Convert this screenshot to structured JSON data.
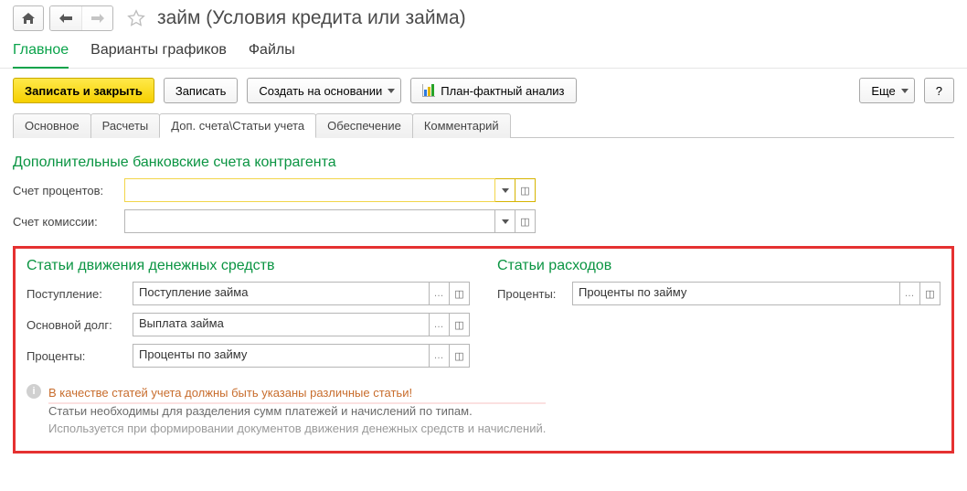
{
  "title": "займ (Условия кредита или займа)",
  "navTabs": {
    "main": "Главное",
    "scheduleVariants": "Варианты графиков",
    "files": "Файлы"
  },
  "toolbar": {
    "saveClose": "Записать и закрыть",
    "save": "Записать",
    "createBasedOn": "Создать на основании",
    "planFact": "План-фактный анализ",
    "more": "Еще",
    "help": "?"
  },
  "subtabs": {
    "main": "Основное",
    "calc": "Расчеты",
    "accounts": "Доп. счета\\Статьи учета",
    "collateral": "Обеспечение",
    "comment": "Комментарий"
  },
  "section1": {
    "title": "Дополнительные банковские счета контрагента",
    "interestAccountLabel": "Счет процентов:",
    "interestAccountValue": "",
    "commissionAccountLabel": "Счет комиссии:",
    "commissionAccountValue": ""
  },
  "section2": {
    "cashflowTitle": "Статьи движения денежных средств",
    "expenseTitle": "Статьи расходов",
    "receiptLabel": "Поступление:",
    "receiptValue": "Поступление займа",
    "principalLabel": "Основной долг:",
    "principalValue": "Выплата займа",
    "interestLabel": "Проценты:",
    "interestValue": "Проценты по займу",
    "expInterestLabel": "Проценты:",
    "expInterestValue": "Проценты по займу",
    "warn": "В качестве статей учета должны быть указаны различные статьи!",
    "hint1": "Статьи необходимы для разделения сумм платежей и начислений по типам.",
    "hint2": "Используется при формировании документов движения денежных средств и начислений."
  }
}
